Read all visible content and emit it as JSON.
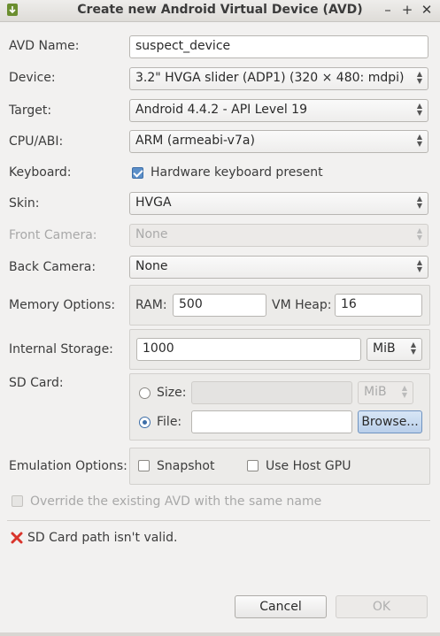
{
  "window": {
    "title": "Create new Android Virtual Device (AVD)",
    "controls": {
      "minimize": "–",
      "maximize": "+",
      "close": "✕"
    }
  },
  "form": {
    "avd_name": {
      "label": "AVD Name:",
      "value": "suspect_device"
    },
    "device": {
      "label": "Device:",
      "value": "3.2\" HVGA slider (ADP1) (320 × 480: mdpi)"
    },
    "target": {
      "label": "Target:",
      "value": "Android 4.4.2 - API Level 19"
    },
    "cpu_abi": {
      "label": "CPU/ABI:",
      "value": "ARM (armeabi-v7a)"
    },
    "keyboard": {
      "label": "Keyboard:",
      "checkbox_label": "Hardware keyboard present",
      "checked": true
    },
    "skin": {
      "label": "Skin:",
      "value": "HVGA"
    },
    "front_camera": {
      "label": "Front Camera:",
      "value": "None",
      "enabled": false
    },
    "back_camera": {
      "label": "Back Camera:",
      "value": "None"
    },
    "memory": {
      "label": "Memory Options:",
      "ram_label": "RAM:",
      "ram_value": "500",
      "heap_label": "VM Heap:",
      "heap_value": "16"
    },
    "internal_storage": {
      "label": "Internal Storage:",
      "value": "1000",
      "unit": "MiB"
    },
    "sd_card": {
      "label": "SD Card:",
      "size_label": "Size:",
      "size_value": "",
      "size_unit": "MiB",
      "file_label": "File:",
      "file_value": "",
      "browse_label": "Browse...",
      "selected": "file"
    },
    "emulation": {
      "label": "Emulation Options:",
      "snapshot_label": "Snapshot",
      "snapshot_checked": false,
      "gpu_label": "Use Host GPU",
      "gpu_checked": false
    },
    "override": {
      "label": "Override the existing AVD with the same name",
      "checked": false,
      "enabled": false
    }
  },
  "status": {
    "error_text": "SD Card path isn't valid.",
    "icon": "error-x-icon",
    "color": "#d9342b"
  },
  "buttons": {
    "cancel": "Cancel",
    "ok": "OK"
  },
  "colors": {
    "accent": "#3d6ea8",
    "background": "#f2f1f0"
  }
}
